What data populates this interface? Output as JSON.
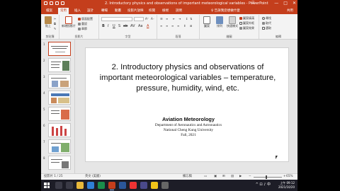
{
  "window": {
    "title": "2. Introductory physics and observations of important meteorological variables - PowerPoint",
    "user_badge": "⊡",
    "minimize": "—",
    "maximize": "□",
    "close": "✕"
  },
  "ribbon_tabs": [
    {
      "label": "檔案"
    },
    {
      "label": "常用"
    },
    {
      "label": "插入"
    },
    {
      "label": "設計"
    },
    {
      "label": "轉場"
    },
    {
      "label": "動畫"
    },
    {
      "label": "投影片放映"
    },
    {
      "label": "校閱"
    },
    {
      "label": "檢視"
    },
    {
      "label": "說明"
    }
  ],
  "tell_me": "♀ 告訴我您想做什麼",
  "share_label": "共用",
  "ribbon": {
    "clipboard": {
      "group_label": "剪貼簿",
      "paste_label": "貼上"
    },
    "slides": {
      "group_label": "投影片",
      "new_slide_label": "新增投影片",
      "layout_label": "版面配置",
      "reset_label": "重設",
      "section_label": "章節"
    },
    "font": {
      "group_label": "字型",
      "format_buttons": [
        "B",
        "I",
        "U",
        "S",
        "ab",
        "AV",
        "Aa",
        "A"
      ]
    },
    "paragraph": {
      "group_label": "段落"
    },
    "drawing": {
      "group_label": "繪圖",
      "shapes_label": "圖案",
      "arrange_label": "排列",
      "quick_styles_label": "快速樣式",
      "shape_fill": "圖案填滿",
      "shape_outline": "圖案外框",
      "shape_effects": "圖案效果"
    },
    "editing": {
      "group_label": "編輯",
      "find_label": "尋找",
      "replace_label": "取代",
      "select_label": "選取"
    }
  },
  "thumbnails": [
    {
      "number": "1"
    },
    {
      "number": "2"
    },
    {
      "number": "3"
    },
    {
      "number": "4"
    },
    {
      "number": "5"
    },
    {
      "number": "6"
    },
    {
      "number": "7"
    },
    {
      "number": "8"
    }
  ],
  "slide": {
    "title": "2. Introductory physics and observations of important meteorological variables – temperature, pressure, humidity, wind, etc.",
    "course": "Aviation Meteorology",
    "department": "Department of Aeronautics and Astronautics",
    "university": "National Cheng Kung University",
    "term": "Fall, 2021"
  },
  "statusbar": {
    "slide_counter": "投影片 1 / 25",
    "language": "英文 (美國)",
    "notes_label": "備忘稿",
    "zoom_percent": "65%",
    "zoom_fraction": 0.45
  },
  "taskbar": {
    "time": "上午 09:12",
    "date": "2021/10/20",
    "tray_icons": "^ ⊡ ♪ 中"
  },
  "colors": {
    "accent": "#c43e1c",
    "taskbar": "#1d1d27"
  }
}
